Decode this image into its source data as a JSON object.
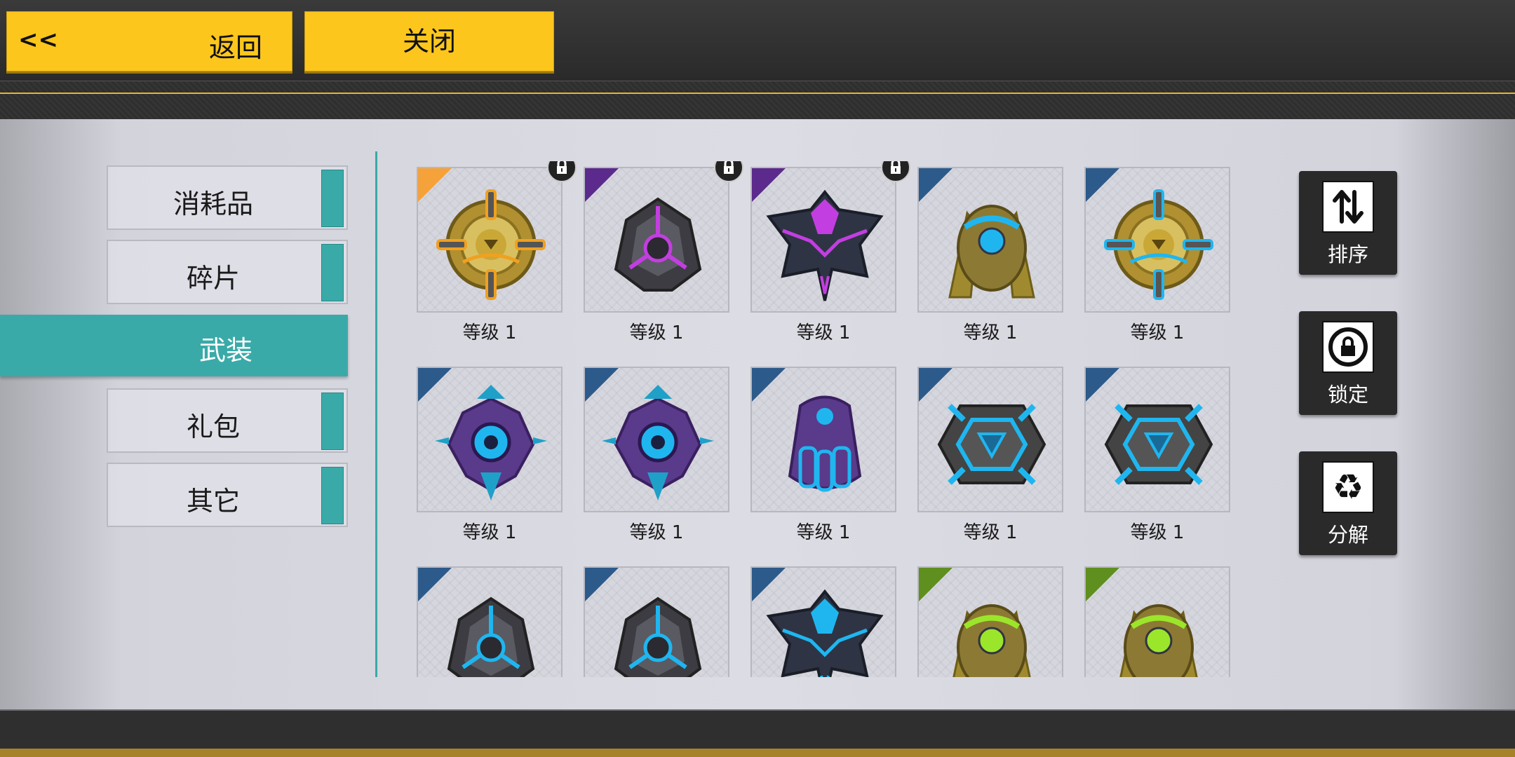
{
  "header": {
    "back_arrow": "<<",
    "back_label": "返回",
    "close_label": "关闭"
  },
  "categories": [
    {
      "label": "消耗品",
      "active": false
    },
    {
      "label": "碎片",
      "active": false
    },
    {
      "label": "武装",
      "active": true
    },
    {
      "label": "礼包",
      "active": false
    },
    {
      "label": "其它",
      "active": false
    }
  ],
  "items": [
    {
      "level": "等级 1",
      "rarity": "#f5a23a",
      "locked": true,
      "icon": "gold-orb-orange-icon"
    },
    {
      "level": "等级 1",
      "rarity": "#5b2a8c",
      "locked": true,
      "icon": "gray-core-magenta-icon"
    },
    {
      "level": "等级 1",
      "rarity": "#5b2a8c",
      "locked": true,
      "icon": "dark-ship-magenta-icon"
    },
    {
      "level": "等级 1",
      "rarity": "#2c5a8a",
      "locked": false,
      "icon": "gold-pod-blue-icon"
    },
    {
      "level": "等级 1",
      "rarity": "#2c5a8a",
      "locked": false,
      "icon": "gold-orb-blue-icon"
    },
    {
      "level": "等级 1",
      "rarity": "#2c5a8a",
      "locked": false,
      "icon": "purple-core-icon"
    },
    {
      "level": "等级 1",
      "rarity": "#2c5a8a",
      "locked": false,
      "icon": "purple-core-icon"
    },
    {
      "level": "等级 1",
      "rarity": "#2c5a8a",
      "locked": false,
      "icon": "purple-shell-icon"
    },
    {
      "level": "等级 1",
      "rarity": "#2c5a8a",
      "locked": false,
      "icon": "gray-hex-blue-icon"
    },
    {
      "level": "等级 1",
      "rarity": "#2c5a8a",
      "locked": false,
      "icon": "gray-hex-blue-icon"
    },
    {
      "level": "",
      "rarity": "#2c5a8a",
      "locked": false,
      "icon": "gray-core-blue-icon"
    },
    {
      "level": "",
      "rarity": "#2c5a8a",
      "locked": false,
      "icon": "gray-core-blue-icon"
    },
    {
      "level": "",
      "rarity": "#2c5a8a",
      "locked": false,
      "icon": "dark-ship-blue-icon"
    },
    {
      "level": "",
      "rarity": "#5f8f1f",
      "locked": false,
      "icon": "gold-pod-green-icon"
    },
    {
      "level": "",
      "rarity": "#5f8f1f",
      "locked": false,
      "icon": "gold-pod-green-icon"
    }
  ],
  "side_buttons": [
    {
      "label": "排序",
      "icon": "sort-icon"
    },
    {
      "label": "锁定",
      "icon": "lock-icon"
    },
    {
      "label": "分解",
      "icon": "recycle-icon"
    }
  ],
  "colors": {
    "accent_teal": "#3aaaa8",
    "button_yellow": "#fcc61d",
    "gold_line": "#e9b529"
  }
}
